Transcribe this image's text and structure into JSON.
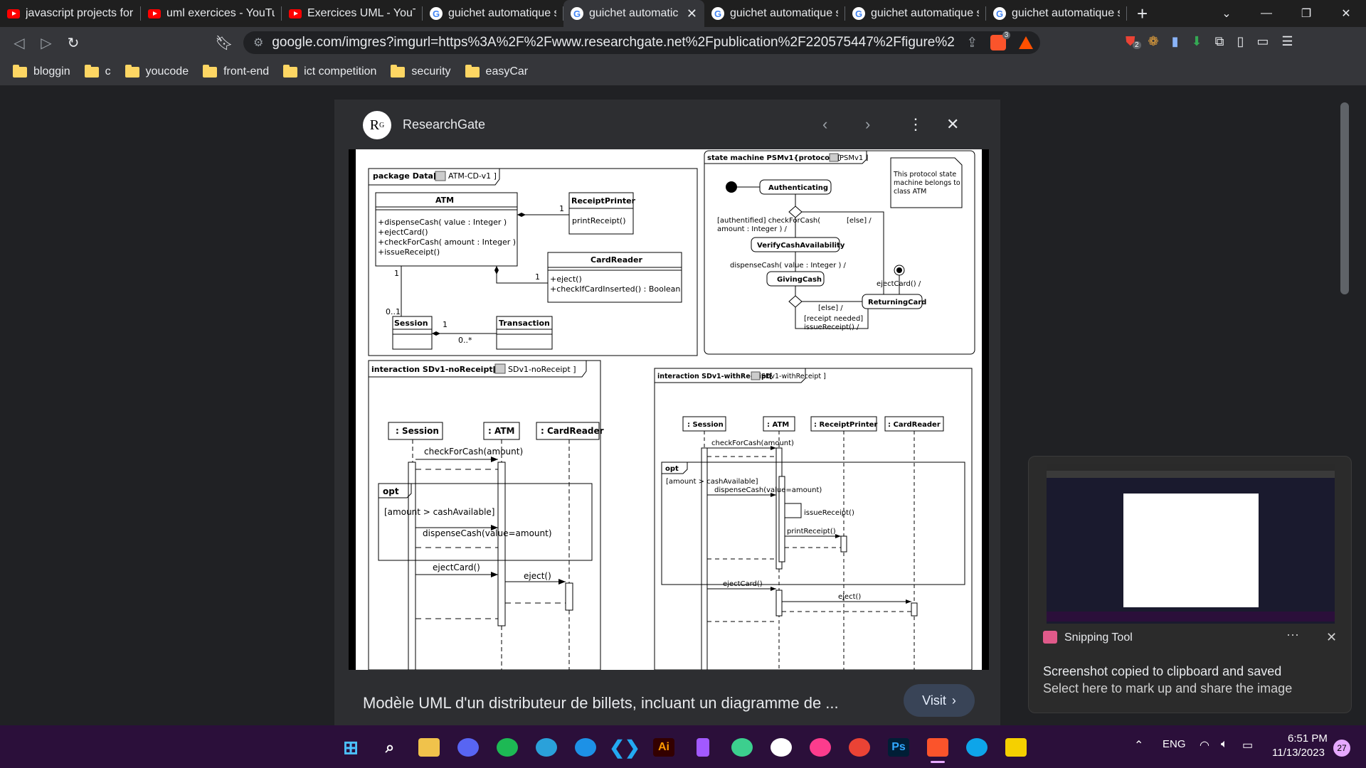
{
  "browser": {
    "tabs": [
      {
        "label": "javascript projects for p",
        "icon": "youtube-icon",
        "active": false
      },
      {
        "label": "uml exercices - YouTub",
        "icon": "youtube-icon",
        "active": false
      },
      {
        "label": "Exercices UML - YouTub",
        "icon": "youtube-icon",
        "active": false
      },
      {
        "label": "guichet automatique s",
        "icon": "google-icon",
        "active": false
      },
      {
        "label": "guichet automatic",
        "icon": "google-icon",
        "active": true
      },
      {
        "label": "guichet automatique s",
        "icon": "google-icon",
        "active": false
      },
      {
        "label": "guichet automatique s",
        "icon": "google-icon",
        "active": false
      },
      {
        "label": "guichet automatique s",
        "icon": "google-icon",
        "active": false
      }
    ],
    "url": "google.com/imgres?imgurl=https%3A%2F%2Fwww.researchgate.net%2Fpublication%2F220575447%2Ffigure%2Ffig1%2...",
    "bookmarks": [
      "bloggin",
      "c",
      "youcode",
      "front-end",
      "ict competition",
      "security",
      "easyCar"
    ],
    "extension_badge": "2",
    "shield_badge": "3"
  },
  "viewer": {
    "source": "ResearchGate",
    "caption": "Modèle UML d'un distributeur de billets, incluant un diagramme de ...",
    "visit_label": "Visit"
  },
  "diagram": {
    "package_title": "package Data[",
    "package_ref": "ATM-CD-v1 ]",
    "atm": {
      "name": "ATM",
      "ops": [
        "+dispenseCash( value : Integer )",
        "+ejectCard()",
        "+checkForCash( amount : Integer )",
        "+issueReceipt()"
      ]
    },
    "receipt_printer": {
      "name": "ReceiptPrinter",
      "ops": [
        "printReceipt()"
      ]
    },
    "card_reader": {
      "name": "CardReader",
      "ops": [
        "+eject()",
        "+checkIfCardInserted() : Boolean"
      ]
    },
    "session": "Session",
    "transaction": "Transaction",
    "mult_1a": "1",
    "mult_1b": "1",
    "mult_1c": "1",
    "mult_01": "0..1",
    "mult_1d": "1",
    "mult_0s": "0..*",
    "sm_title": "state machine PSMv1{protocol}[",
    "sm_ref": "PSMv1 ]",
    "sm_note": [
      "This protocol state",
      "machine belongs to",
      "class ATM"
    ],
    "states": [
      "Authenticating",
      "VerifyCashAvailability",
      "GivingCash",
      "ReturningCard"
    ],
    "sm_labels": [
      "[authentified] checkForCash(",
      "amount : Integer ) /",
      "[else] /",
      "dispenseCash( value : Integer ) /",
      "ejectCard() /",
      "[else] /",
      "[receipt needed]",
      "issueReceipt() /"
    ],
    "sd1_title": "interaction SDv1-noReceipt[",
    "sd1_ref": "SDv1-noReceipt ]",
    "sd1_lifelines": [
      ": Session",
      ": ATM",
      ": CardReader"
    ],
    "sd1_msgs": [
      "checkForCash(amount)",
      "dispenseCash(value=amount)",
      "ejectCard()",
      "eject()"
    ],
    "sd1_opt": "opt",
    "sd1_guard": "[amount > cashAvailable]",
    "sd2_title": "interaction SDv1-withReceipt[",
    "sd2_ref": "SDv1-withReceipt ]",
    "sd2_lifelines": [
      ": Session",
      ": ATM",
      ": ReceiptPrinter",
      ": CardReader"
    ],
    "sd2_msgs": [
      "checkForCash(amount)",
      "dispenseCash(value=amount)",
      "issueReceipt()",
      "printReceipt()",
      "ejectCard()",
      "eject()"
    ],
    "sd2_opt": "opt",
    "sd2_guard": "[amount > cashAvailable]"
  },
  "toast": {
    "app": "Snipping Tool",
    "title": "Screenshot copied to clipboard and saved",
    "message": "Select here to mark up and share the image"
  },
  "taskbar": {
    "lang": "ENG",
    "time": "6:51 PM",
    "date": "11/13/2023",
    "notif_count": "27"
  }
}
